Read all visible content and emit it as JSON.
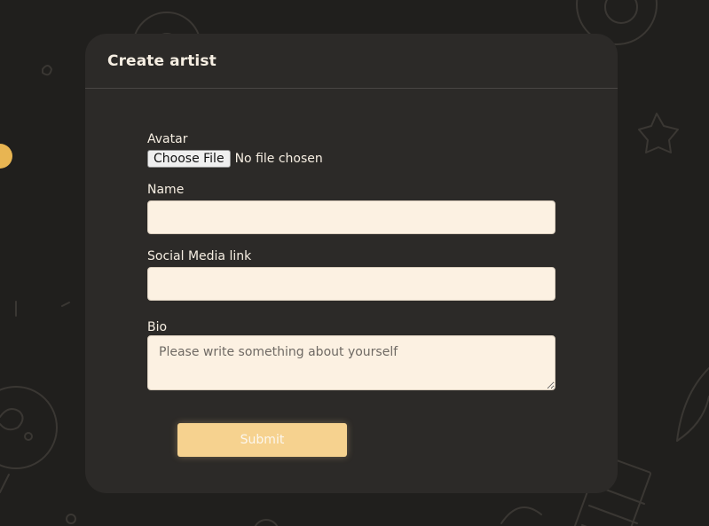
{
  "modal": {
    "title": "Create artist"
  },
  "form": {
    "avatar_label": "Avatar",
    "file_button_label": "Choose File",
    "file_status": "No file chosen",
    "name_label": "Name",
    "name_value": "",
    "social_label": "Social Media link",
    "social_value": "",
    "bio_label": "Bio",
    "bio_placeholder": "Please write something about yourself",
    "bio_value": "",
    "submit_label": "Submit"
  },
  "colors": {
    "page_background": "#201f1d",
    "modal_background": "#2c2a28",
    "input_background": "#fcf1e2",
    "accent": "#f6d28f",
    "text": "#f6eee2"
  }
}
